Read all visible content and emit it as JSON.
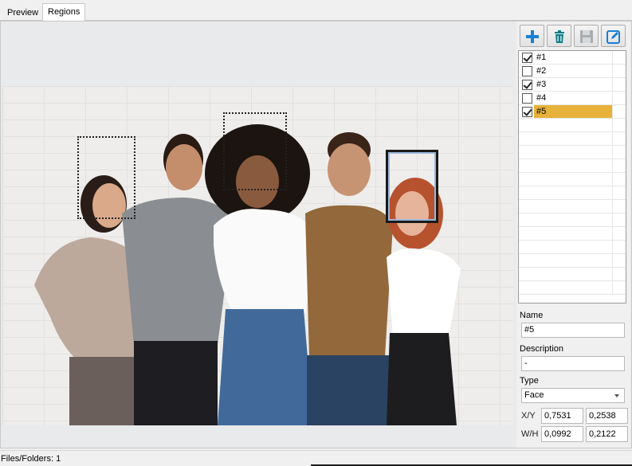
{
  "tabs": [
    {
      "label": "Preview",
      "active": false
    },
    {
      "label": "Regions",
      "active": true
    }
  ],
  "toolbar": {
    "add_icon": "plus-icon",
    "delete_icon": "trash-icon",
    "save_icon": "floppy-disk-icon",
    "edit_icon": "edit-icon"
  },
  "regions": [
    {
      "label": "#1",
      "checked": true,
      "selected": false
    },
    {
      "label": "#2",
      "checked": false,
      "selected": false
    },
    {
      "label": "#3",
      "checked": true,
      "selected": false
    },
    {
      "label": "#4",
      "checked": false,
      "selected": false
    },
    {
      "label": "#5",
      "checked": true,
      "selected": true
    }
  ],
  "properties": {
    "name_label": "Name",
    "name_value": "#5",
    "description_label": "Description",
    "description_value": "-",
    "type_label": "Type",
    "type_value": "Face",
    "xy_label": "X/Y",
    "x_value": "0,7531",
    "y_value": "0,2538",
    "wh_label": "W/H",
    "w_value": "0,0992",
    "h_value": "0,2122"
  },
  "status": {
    "text": "Files/Folders: 1"
  },
  "colors": {
    "selection": "#e6b23a",
    "accent_blue": "#1a7fd4"
  }
}
